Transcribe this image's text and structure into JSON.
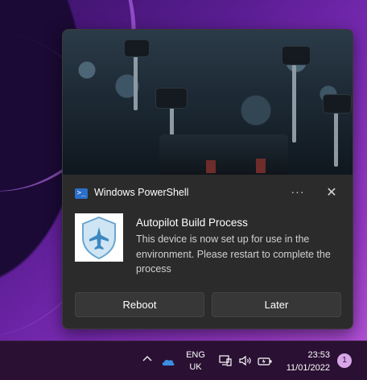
{
  "toast": {
    "app_name": "Windows PowerShell",
    "app_icon": "powershell-icon",
    "more_label": "···",
    "close_label": "✕",
    "title": "Autopilot Build Process",
    "message": "This device is now set up for use in the environment. Please restart to complete the process",
    "thumbnail_icon": "shield-airplane-icon",
    "actions": {
      "primary_label": "Reboot",
      "secondary_label": "Later"
    }
  },
  "taskbar": {
    "chevron_label": "^",
    "lang_line1": "ENG",
    "lang_line2": "UK",
    "time": "23:53",
    "date": "11/01/2022",
    "notification_count": "1"
  },
  "colors": {
    "toast_background": "#2b2b2b",
    "button_background": "#373737",
    "accent_blue": "#2a6fc9",
    "taskbar_background": "#2a1033",
    "badge": "#d7a6e8"
  }
}
